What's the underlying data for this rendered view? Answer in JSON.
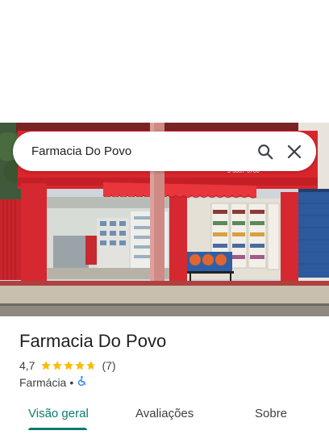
{
  "search": {
    "query": "Farmacia Do Povo"
  },
  "icons": {
    "search": "search-icon",
    "close": "close-icon",
    "accessibility": "wheelchair-icon",
    "star": "star-icon"
  },
  "place": {
    "name": "Farmacia Do Povo",
    "rating": "4,7",
    "rating_value": 4.7,
    "review_count": "(7)",
    "category": "Farmácia",
    "separator": "•"
  },
  "storefront_sign": {
    "phone_partial": "3-6037-6706"
  },
  "tabs": [
    {
      "label": "Visão geral",
      "active": true
    },
    {
      "label": "Avaliações",
      "active": false
    },
    {
      "label": "Sobre",
      "active": false
    }
  ],
  "colors": {
    "accent": "#0b7a72",
    "star": "#fbbc04",
    "accessibility": "#1a73e8"
  }
}
